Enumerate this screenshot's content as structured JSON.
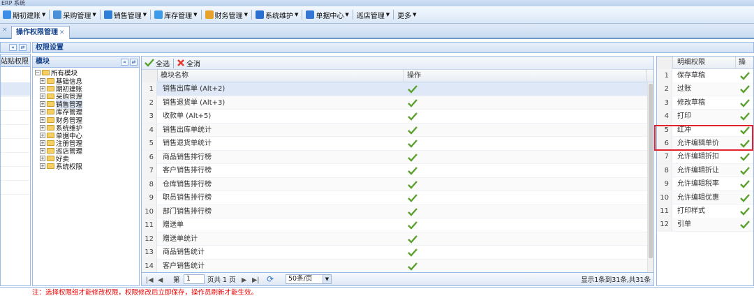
{
  "window": {
    "title": "ERP 系统"
  },
  "menu": [
    {
      "label": "期初建账",
      "icon": "ledger-icon"
    },
    {
      "label": "采购管理",
      "icon": "purchase-icon"
    },
    {
      "label": "销售管理",
      "icon": "sales-icon"
    },
    {
      "label": "库存管理",
      "icon": "inventory-icon"
    },
    {
      "label": "财务管理",
      "icon": "finance-icon"
    },
    {
      "label": "系统维护",
      "icon": "maintenance-icon"
    },
    {
      "label": "单据中心",
      "icon": "document-center-icon"
    },
    {
      "label": "巡店管理",
      "icon": ""
    },
    {
      "label": "更多",
      "icon": ""
    }
  ],
  "tabs": [
    {
      "label": "操作权限管理"
    }
  ],
  "left_panel": {
    "partial_label": "站贴权限"
  },
  "perm_panel": {
    "title": "权限设置"
  },
  "module_panel": {
    "title": "模块"
  },
  "tree": {
    "root": "所有模块",
    "children": [
      "基础信息",
      "期初建账",
      "采购管理",
      "销售管理",
      "库存管理",
      "财务管理",
      "系统维护",
      "单据中心",
      "注册管理",
      "巡店管理",
      "好卖",
      "系统权限"
    ],
    "selected": "销售管理"
  },
  "toolbar": {
    "select_all": "全选",
    "deselect_all": "全消"
  },
  "main_grid": {
    "columns": [
      "模块名称",
      "操作"
    ],
    "rows": [
      {
        "n": "1",
        "name": "销售出库单 (Alt+2)",
        "checked": true
      },
      {
        "n": "2",
        "name": "销售退货单 (Alt+3)",
        "checked": true
      },
      {
        "n": "3",
        "name": "收款单 (Alt+5)",
        "checked": true
      },
      {
        "n": "4",
        "name": "销售出库单统计",
        "checked": true
      },
      {
        "n": "5",
        "name": "销售退货单统计",
        "checked": true
      },
      {
        "n": "6",
        "name": "商品销售排行榜",
        "checked": true
      },
      {
        "n": "7",
        "name": "客户销售排行榜",
        "checked": true
      },
      {
        "n": "8",
        "name": "仓库销售排行榜",
        "checked": true
      },
      {
        "n": "9",
        "name": "职员销售排行榜",
        "checked": true
      },
      {
        "n": "10",
        "name": "部门销售排行榜",
        "checked": true
      },
      {
        "n": "11",
        "name": "赠送单",
        "checked": true
      },
      {
        "n": "12",
        "name": "赠送单统计",
        "checked": true
      },
      {
        "n": "13",
        "name": "商品销售统计",
        "checked": true
      },
      {
        "n": "14",
        "name": "客户销售统计",
        "checked": true
      }
    ],
    "selected_row": "1"
  },
  "pager": {
    "page_label_pre": "第",
    "page_value": "1",
    "page_label_post": "页共 1 页",
    "page_size": "50条/页",
    "summary": "显示1条到31条,共31条"
  },
  "detail_grid": {
    "columns": [
      "明细权限",
      "操"
    ],
    "rows": [
      {
        "n": "1",
        "name": "保存草稿",
        "checked": true
      },
      {
        "n": "2",
        "name": "过账",
        "checked": true
      },
      {
        "n": "3",
        "name": "修改草稿",
        "checked": true
      },
      {
        "n": "4",
        "name": "打印",
        "checked": true
      },
      {
        "n": "5",
        "name": "红冲",
        "checked": true
      },
      {
        "n": "6",
        "name": "允许编辑单价",
        "checked": true
      },
      {
        "n": "7",
        "name": "允许编辑折扣",
        "checked": true
      },
      {
        "n": "8",
        "name": "允许编辑折让",
        "checked": true
      },
      {
        "n": "9",
        "name": "允许编辑税率",
        "checked": true
      },
      {
        "n": "10",
        "name": "允许编辑优惠",
        "checked": true
      },
      {
        "n": "11",
        "name": "打印样式",
        "checked": true
      },
      {
        "n": "12",
        "name": "引单",
        "checked": true
      }
    ],
    "highlighted_row": "6"
  },
  "footer_note": "注：选择权限组才能修改权限，权限修改后立即保存，操作员刷新才能生效。",
  "colors": {
    "check": "#5aa02c",
    "highlight": "#e3232b",
    "header_text": "#15428b",
    "note": "#e00000"
  }
}
